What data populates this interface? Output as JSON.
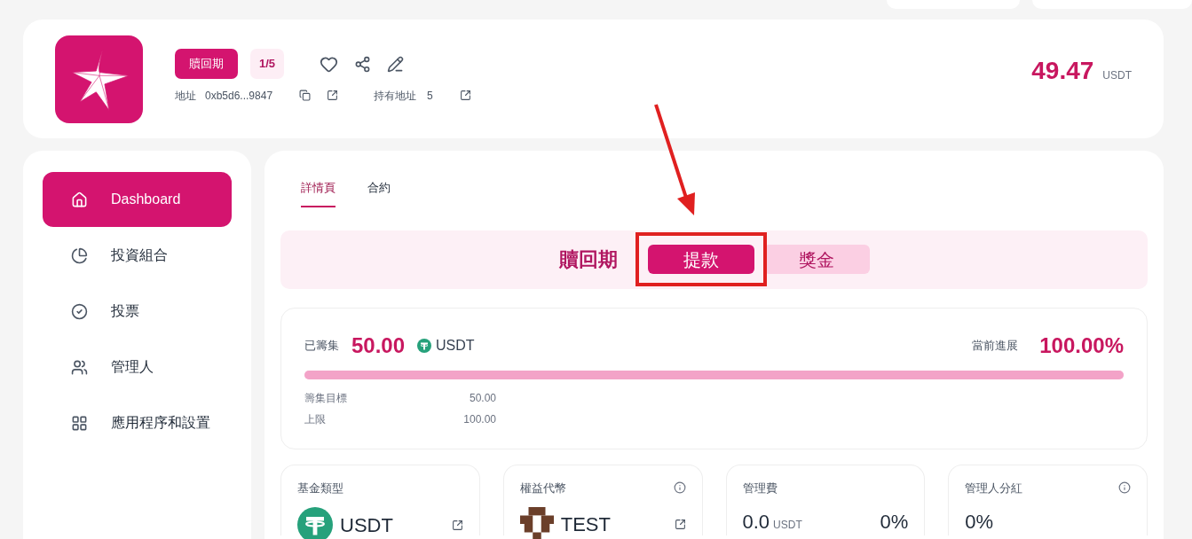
{
  "header": {
    "status_badge": "贖回期",
    "round_badge": "1/5",
    "address_label": "地址",
    "address": "0xb5d6...9847",
    "holders_label": "持有地址",
    "holders": "5",
    "balance": "49.47",
    "balance_unit": "USDT"
  },
  "sidebar": {
    "items": [
      {
        "label": "Dashboard",
        "selected": true
      },
      {
        "label": "投資組合",
        "selected": false
      },
      {
        "label": "投票",
        "selected": false
      },
      {
        "label": "管理人",
        "selected": false
      },
      {
        "label": "應用程序和設置",
        "selected": false
      }
    ]
  },
  "tabs": [
    {
      "label": "詳情頁",
      "selected": true
    },
    {
      "label": "合約",
      "selected": false
    }
  ],
  "phase": {
    "title": "贖回期",
    "buttons": [
      {
        "label": "提款",
        "selected": true,
        "highlighted": true
      },
      {
        "label": "獎金",
        "selected": false,
        "highlighted": false
      }
    ]
  },
  "raise": {
    "raised_label": "已籌集",
    "raised": "50.00",
    "currency": "USDT",
    "progress_label": "當前進展",
    "progress": "100.00%",
    "level": 1,
    "target_label": "籌集目標",
    "target": "50.00",
    "cap_label": "上限",
    "cap": "100.00"
  },
  "cards": [
    {
      "kind": "coin",
      "label": "基金類型",
      "info": false,
      "value": "USDT",
      "link": true
    },
    {
      "kind": "token",
      "label": "權益代幣",
      "info": true,
      "value": "TEST",
      "link": true
    },
    {
      "kind": "fee",
      "label": "管理費",
      "info": false,
      "value": "0.0",
      "unit": "USDT",
      "percent": "0%"
    },
    {
      "kind": "plain",
      "label": "管理人分紅",
      "info": true,
      "value": "0%"
    }
  ]
}
